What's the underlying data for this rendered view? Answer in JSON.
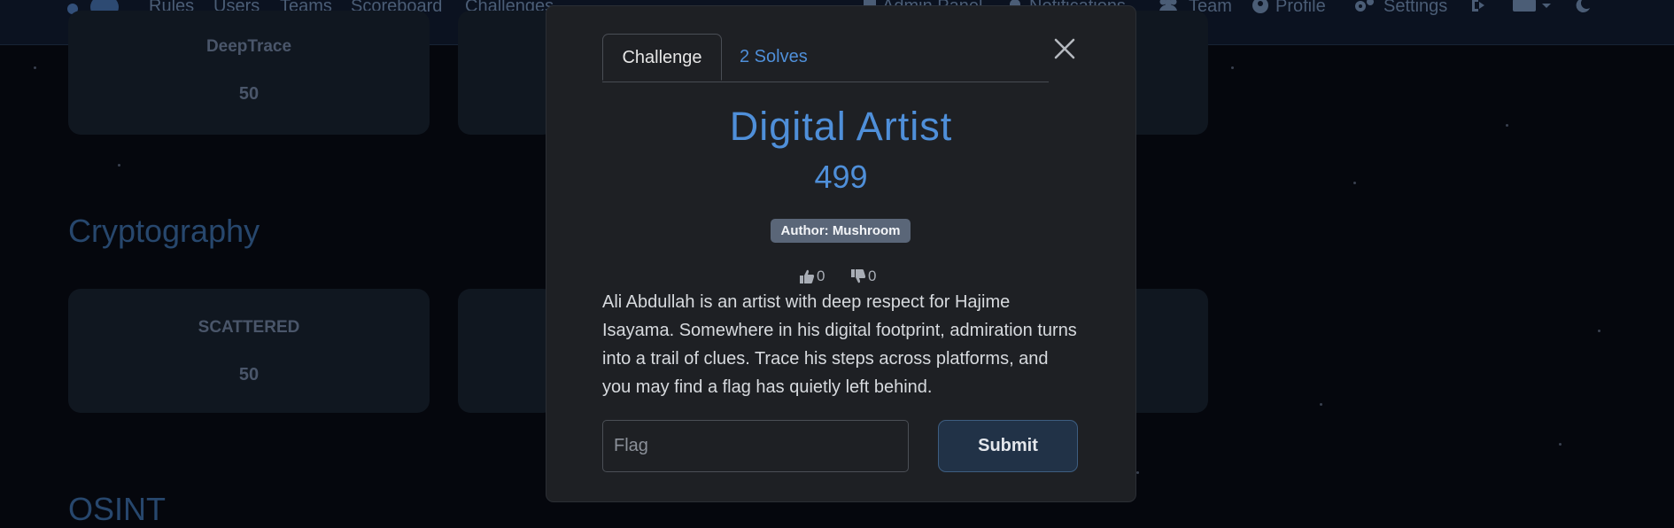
{
  "navbar": {
    "links": [
      "Rules",
      "Users",
      "Teams",
      "Scoreboard",
      "Challenges"
    ],
    "admin_label": "Admin Panel",
    "notifications_label": "Notifications",
    "team_label": "Team",
    "profile_label": "Profile",
    "settings_label": "Settings",
    "icons": [
      "logout-icon",
      "language-icon",
      "moon-icon"
    ]
  },
  "background": {
    "cards": [
      {
        "title": "DeepTrace",
        "value": "50"
      },
      {
        "title": "SCATTERED",
        "value": "50"
      }
    ],
    "sections": [
      "Cryptography",
      "OSINT"
    ]
  },
  "modal": {
    "tabs": {
      "challenge": "Challenge",
      "solves": "2 Solves"
    },
    "name": "Digital Artist",
    "value": "499",
    "author": "Author: Mushroom",
    "upvotes": "0",
    "downvotes": "0",
    "description": "Ali Abdullah is an artist with deep respect for Hajime Isayama. Somewhere in his digital footprint, admiration turns into a trail of clues. Trace his steps across platforms, and you may find a flag has quietly left behind.",
    "flag_placeholder": "Flag",
    "submit_label": "Submit"
  },
  "colors": {
    "accent": "#4f8fd9",
    "modal_bg": "#1e2024",
    "badge_bg": "#5a6678",
    "submit_bg": "#213247"
  }
}
